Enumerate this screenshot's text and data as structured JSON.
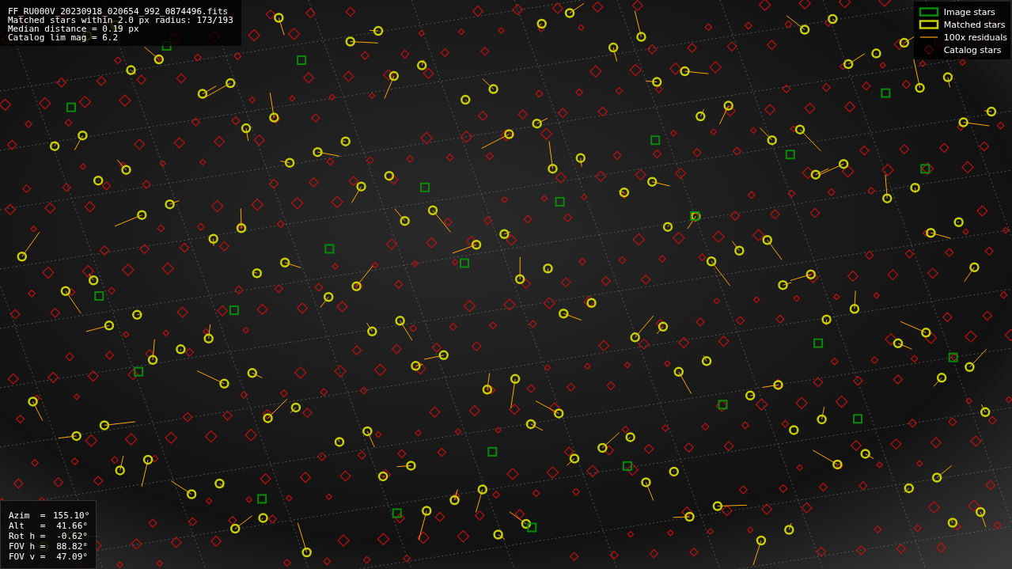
{
  "info_panel": {
    "lines": [
      "FF_RU000V_20230918_020654_992_0874496.fits",
      "Matched stars within 2.0 px radius: 173/193",
      "Median distance = 0.19 px",
      "Catalog lim mag = 6.2"
    ]
  },
  "legend": [
    {
      "kind": "image",
      "label": "Image stars"
    },
    {
      "kind": "matched",
      "label": "Matched stars"
    },
    {
      "kind": "residual",
      "label": "100x residuals"
    },
    {
      "kind": "catalog",
      "label": "Catalog stars"
    }
  ],
  "pointing": [
    {
      "label": "Azim  =",
      "value": "155.10°"
    },
    {
      "label": "Alt   =",
      "value": "41.66°"
    },
    {
      "label": "Rot h =",
      "value": "-0.62°"
    },
    {
      "label": "FOV h =",
      "value": "88.82°"
    },
    {
      "label": "FOV v =",
      "value": "47.09°"
    }
  ]
}
